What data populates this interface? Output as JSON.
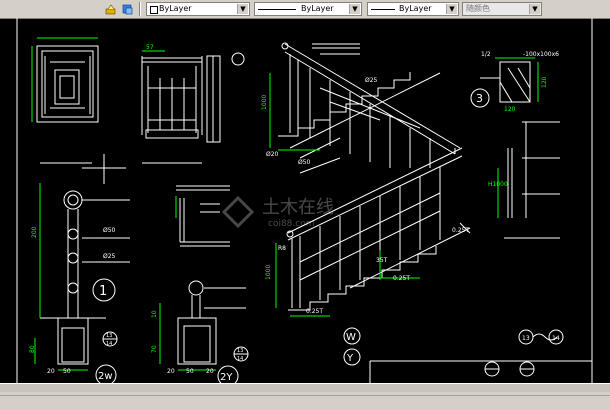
{
  "toolbar": {
    "icons": [
      "layer-state-icon",
      "layer-manager-icon"
    ],
    "color_combo": {
      "value": "ByLayer"
    },
    "linetype_combo": {
      "value": "ByLayer"
    },
    "lineweight_combo": {
      "value": "ByLayer"
    },
    "plotstyle_combo": {
      "value": "随颜色"
    }
  },
  "drawing": {
    "background": "#000000",
    "colors": {
      "white": "#ffffff",
      "green": "#00ff00",
      "cyan": "#00ffff",
      "grey": "#808080"
    },
    "labels": {
      "t_57": "57",
      "t_120": "1/2",
      "t_steel": "-100x100x6",
      "t_120b": "120",
      "t_120c": "120",
      "t_1000a": "1000",
      "t_1000b": "1000",
      "t_1000c": "1000",
      "t_phi25a": "Ø25",
      "t_phi20": "Ø20",
      "t_phi50a": "Ø50",
      "t_phi50b": "Ø50",
      "t_phi25b": "Ø25",
      "t_h1000": "H1000",
      "t_200": "200",
      "t_r8": "R8",
      "t_0257a": "0.25T",
      "t_0257b": "0.25T",
      "t_0257c": "0.25T",
      "t_35t": "35T",
      "t_circle3": "3",
      "t_circle1": "1",
      "t_circle2w": "2w",
      "t_circle2y": "2Y",
      "t_w": "W",
      "t_y": "Y",
      "t_13": "13",
      "t_14": "14",
      "t_13b": "13",
      "t_14b": "14",
      "t_sub": "13",
      "t_sub2": "14",
      "t_20a": "20",
      "t_50a": "50",
      "t_20b": "20",
      "t_50b": "50",
      "t_20c": "20",
      "t_80": "80",
      "t_70": "70",
      "t_10": "10",
      "watermark_cn": "土木在线",
      "watermark_en": "coi88.com"
    }
  }
}
